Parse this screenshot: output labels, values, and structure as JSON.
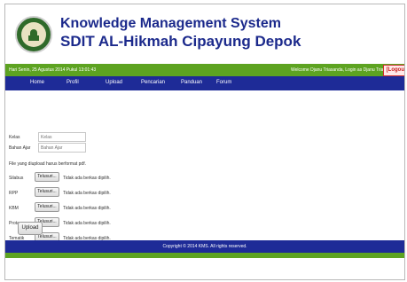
{
  "header": {
    "title_line1": "Knowledge Management System",
    "title_line2": "SDIT AL-Hikmah Cipayung Depok"
  },
  "status_bar": {
    "datetime": "Hari Senin, 25 Agustus 2014 Pukul 13:01:43",
    "welcome": "Welcome Djanu Triasanda, Login as Djanu Triasanda",
    "logout_label": "[Logout]"
  },
  "nav": {
    "items": [
      "Home",
      "Profil",
      "Upload",
      "Pencarian",
      "Panduan",
      "Forum"
    ]
  },
  "form": {
    "kelas_label": "Kelas",
    "kelas_placeholder": "Kelas",
    "bahan_ajar_label": "Bahan Ajar",
    "bahan_ajar_placeholder": "Bahan Ajar",
    "note": "File yang diupload harus berformat pdf.",
    "files": [
      {
        "label": "Silabus",
        "button": "Telusuri...",
        "status": "Tidak ada berkas dipilih."
      },
      {
        "label": "RPP",
        "button": "Telusuri...",
        "status": "Tidak ada berkas dipilih."
      },
      {
        "label": "KBM",
        "button": "Telusuri...",
        "status": "Tidak ada berkas dipilih."
      },
      {
        "label": "Prota",
        "button": "Telusuri...",
        "status": "Tidak ada berkas dipilih."
      },
      {
        "label": "Tematik",
        "button": "Telusuri...",
        "status": "Tidak ada berkas dipilih."
      }
    ],
    "upload_label": "Upload"
  },
  "footer": {
    "copyright": "Copyright © 2014 KMS. All rights reserved."
  },
  "colors": {
    "brand_blue": "#1e2b97",
    "status_green": "#5da321",
    "logout_red": "#c81f1f"
  }
}
